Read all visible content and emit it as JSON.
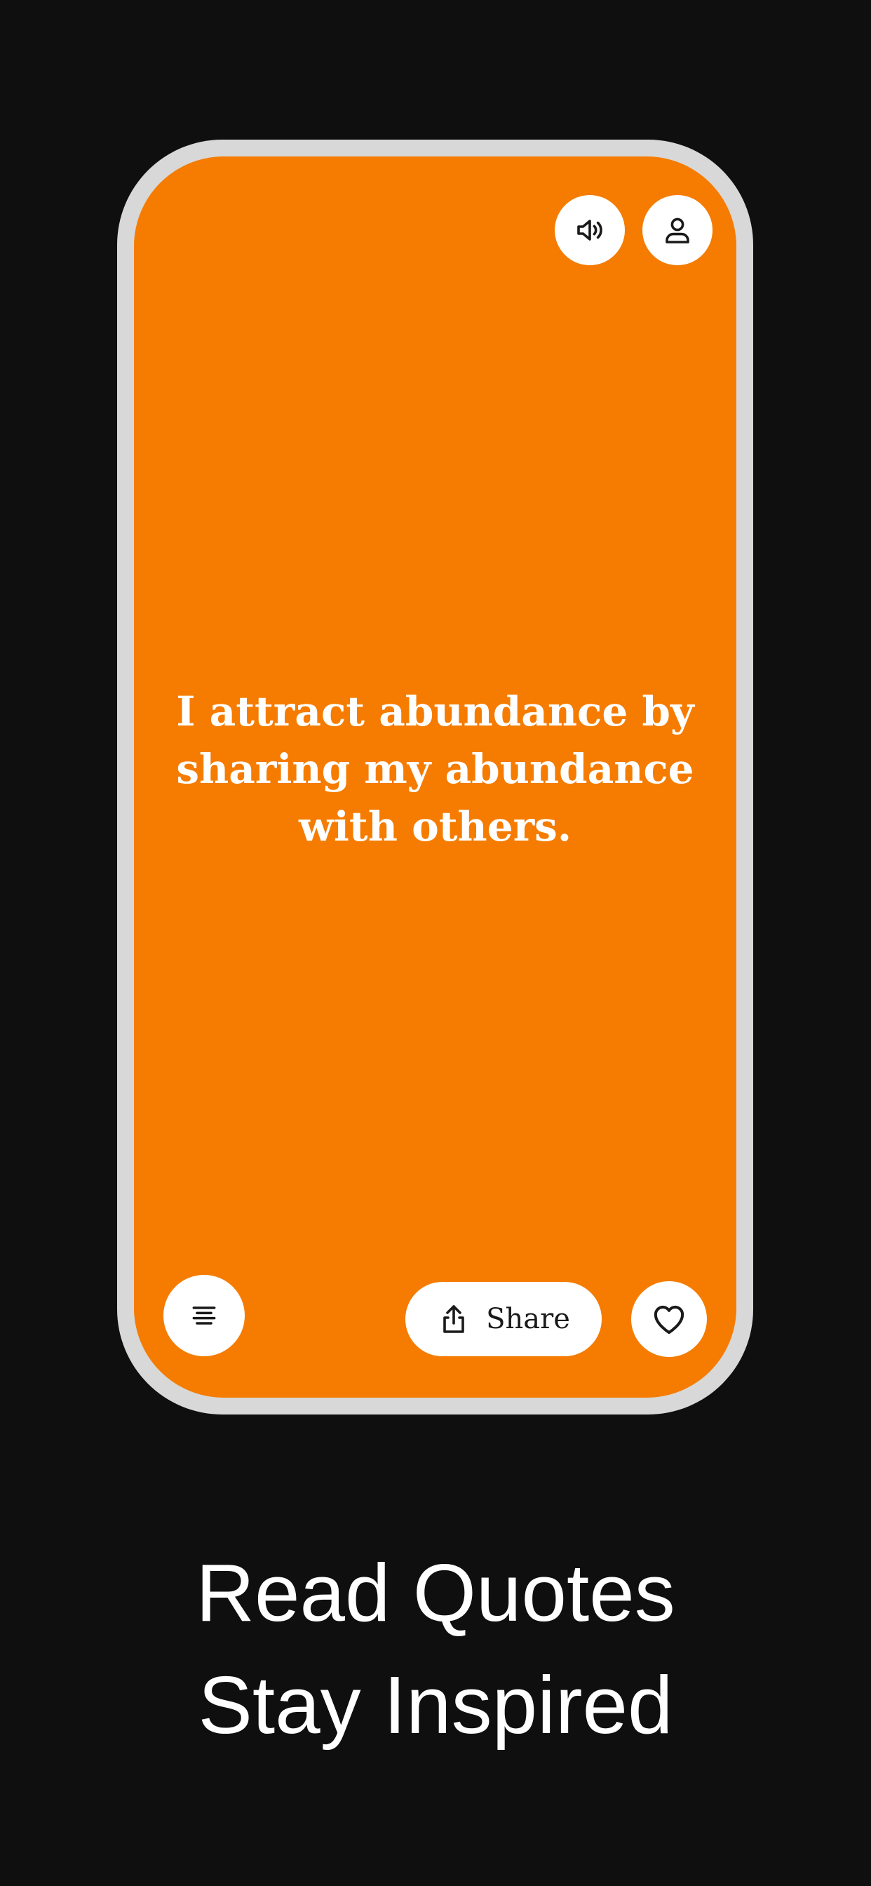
{
  "app": {
    "icons": {
      "sound": "speaker-volume-icon",
      "profile": "user-profile-icon",
      "menu": "align-center-menu-icon",
      "share": "share-upload-icon",
      "like": "heart-icon"
    },
    "colors": {
      "background": "#0f0f0f",
      "frame": "#d8d8d8",
      "card": "#f57c00",
      "text": "#ffffff",
      "button": "#ffffff",
      "button_text": "#1a1a1a"
    }
  },
  "card": {
    "quote": "I attract abundance by sharing my abundance with others."
  },
  "actions": {
    "share_label": "Share"
  },
  "promo": {
    "line1": "Read Quotes",
    "line2": "Stay Inspired"
  }
}
